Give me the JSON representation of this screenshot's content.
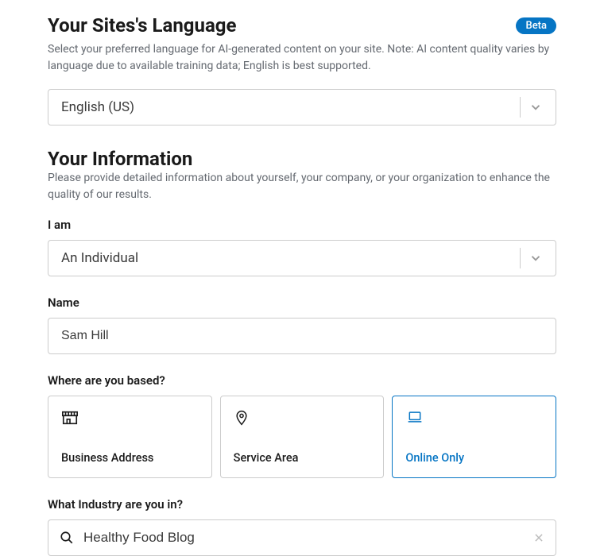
{
  "language_section": {
    "title": "Your Sites's Language",
    "badge": "Beta",
    "subtitle": "Select your preferred language for AI-generated content on your site. Note: AI content quality varies by language due to available training data; English is best supported.",
    "selected": "English (US)"
  },
  "info_section": {
    "title": "Your Information",
    "subtitle": "Please provide detailed information about yourself, your company, or your organization to enhance the quality of our results."
  },
  "iam": {
    "label": "I am",
    "selected": "An Individual"
  },
  "name": {
    "label": "Name",
    "value": "Sam Hill"
  },
  "location": {
    "label": "Where are you based?",
    "options": {
      "business": "Business Address",
      "service": "Service Area",
      "online": "Online Only"
    }
  },
  "industry": {
    "label": "What Industry are you in?",
    "value": "Healthy Food Blog"
  }
}
